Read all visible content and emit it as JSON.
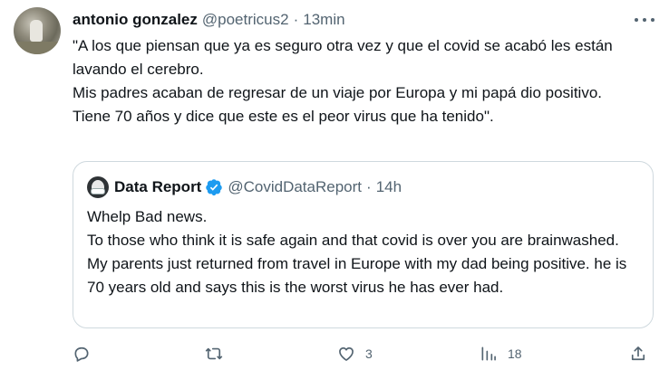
{
  "tweet": {
    "author_name": "antonio gonzalez",
    "handle": "@poetricus2",
    "separator": "·",
    "time": "13min",
    "text": "\"A los que piensan que ya es seguro otra vez y que el covid se acabó les están lavando el cerebro.\nMis padres acaban de regresar de un viaje por Europa y mi papá dio positivo.\nTiene 70 años y dice que este es el peor virus que ha tenido\"."
  },
  "quote": {
    "author_name": "Data Report",
    "verified": true,
    "handle": "@CovidDataReport",
    "separator": "·",
    "time": "14h",
    "text": "Whelp Bad news.\nTo those who think it is safe again and that covid is over you are brainwashed. My parents just returned from travel in Europe with my dad being positive. he is 70 years old and says this is the worst virus he has ever had."
  },
  "actions": {
    "reply_count": "",
    "retweet_count": "",
    "like_count": "3",
    "views_count": "18"
  },
  "icons": {
    "more": "more-icon",
    "verified": "verified-badge-icon",
    "reply": "reply-icon",
    "retweet": "retweet-icon",
    "like": "heart-icon",
    "views": "views-icon",
    "share": "share-icon"
  },
  "colors": {
    "verified": "#1d9bf0",
    "muted": "#536471",
    "border": "#cfd9de",
    "text": "#0f1419"
  }
}
